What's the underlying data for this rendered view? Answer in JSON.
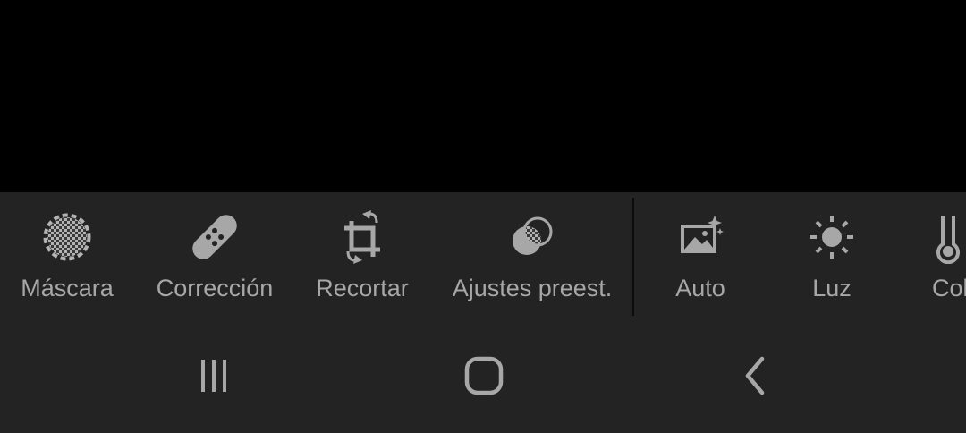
{
  "toolbar": {
    "tools": [
      {
        "label": "Máscara",
        "icon": "mask-icon"
      },
      {
        "label": "Corrección",
        "icon": "bandage-icon"
      },
      {
        "label": "Recortar",
        "icon": "crop-rotate-icon"
      },
      {
        "label": "Ajustes preest.",
        "icon": "presets-icon"
      },
      {
        "label": "Auto",
        "icon": "auto-image-sparkle-icon"
      },
      {
        "label": "Luz",
        "icon": "sun-icon"
      },
      {
        "label": "Col",
        "icon": "thermometer-icon"
      }
    ]
  },
  "navbar": {
    "buttons": [
      {
        "icon": "recent-apps-icon"
      },
      {
        "icon": "home-icon"
      },
      {
        "icon": "back-icon"
      }
    ]
  },
  "colors": {
    "toolbar_bg": "#232323",
    "icon_gray": "#a7a7a7",
    "preview_bg": "#000000"
  }
}
